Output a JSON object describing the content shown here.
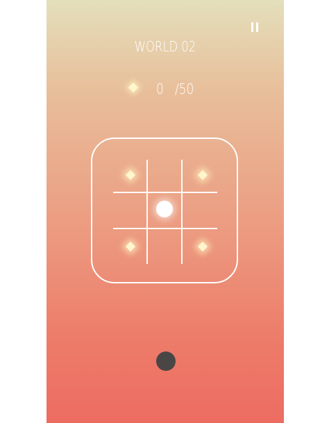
{
  "header": {
    "title": "WORLD 02",
    "pause_icon": "pause-icon"
  },
  "score": {
    "icon": "gem-icon",
    "collected": "0",
    "total": "/50"
  },
  "board": {
    "grid": "3x3",
    "gems": [
      "top-left",
      "top-right",
      "bottom-left",
      "bottom-right"
    ],
    "ball_cell": "center"
  },
  "colors": {
    "gradient_top": "#e4dfbb",
    "gradient_bottom": "#ed6c62",
    "gem": "#fff6cf",
    "control_dot": "#4a4646"
  }
}
